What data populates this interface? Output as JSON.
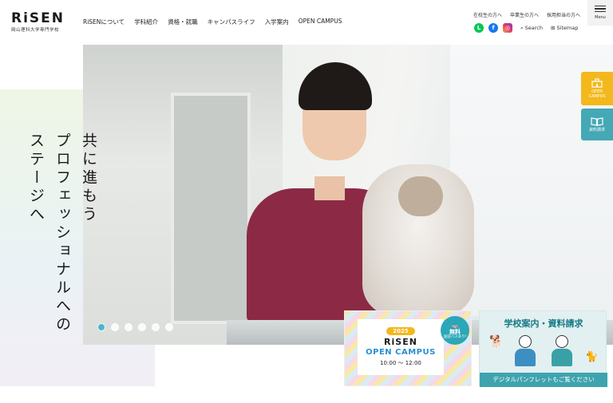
{
  "header": {
    "logo_main": "RiSEN",
    "logo_sub": "岡山理科大学専門学校",
    "nav": [
      "RiSENについて",
      "学科紹介",
      "資格・就職",
      "キャンパスライフ",
      "入学案内",
      "OPEN CAMPUS"
    ],
    "subnav": [
      "在校生の方へ",
      "卒業生の方へ",
      "採用担当の方へ"
    ],
    "search_label": "Search",
    "sitemap_label": "Sitemap",
    "menu_label": "Menu"
  },
  "hero": {
    "catch_lines": [
      "共に進もう",
      "プロフェッショナルへの",
      "ステージへ"
    ],
    "slides_total": 6,
    "active_slide": 1
  },
  "side": {
    "open_campus": "OPEN\nCAMPUS",
    "doc_request": "資料請求"
  },
  "banner_oc": {
    "year": "2025",
    "brand": "RiSEN",
    "title": "OPEN CAMPUS",
    "time": "10:00 ～ 12:00",
    "badge_main": "無料",
    "badge_sub": "送迎バスあり!"
  },
  "banner_doc": {
    "title": "学校案内・資料請求",
    "footer": "デジタルパンフレットもご覧ください"
  },
  "colors": {
    "accent_yellow": "#f3b81c",
    "accent_teal": "#45a8b5",
    "slider_active": "#48b8c9"
  }
}
